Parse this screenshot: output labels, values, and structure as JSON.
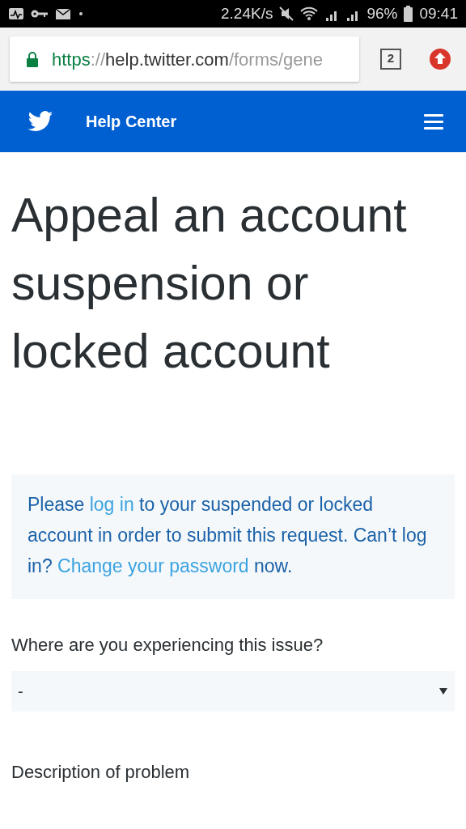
{
  "status_bar": {
    "speed": "2.24K/s",
    "battery": "96%",
    "time": "09:41"
  },
  "browser": {
    "url": {
      "scheme": "https",
      "separator": "://",
      "host": "help.twitter.com",
      "path": "/forms/gene"
    },
    "tab_count": "2"
  },
  "header": {
    "title": "Help Center"
  },
  "heading": "Appeal an account suspension or locked account",
  "notice": [
    {
      "kind": "text",
      "text": "Please "
    },
    {
      "kind": "link",
      "text": "log in"
    },
    {
      "kind": "text",
      "text": " to your suspended or locked account in order to submit this request. Can’t log in? "
    },
    {
      "kind": "link",
      "text": "Change your password"
    },
    {
      "kind": "text",
      "text": " now."
    }
  ],
  "fields": [
    {
      "kind": "select",
      "label": "Where are you experiencing this issue?",
      "value": "-"
    },
    {
      "kind": "label",
      "label": "Description of problem"
    }
  ]
}
